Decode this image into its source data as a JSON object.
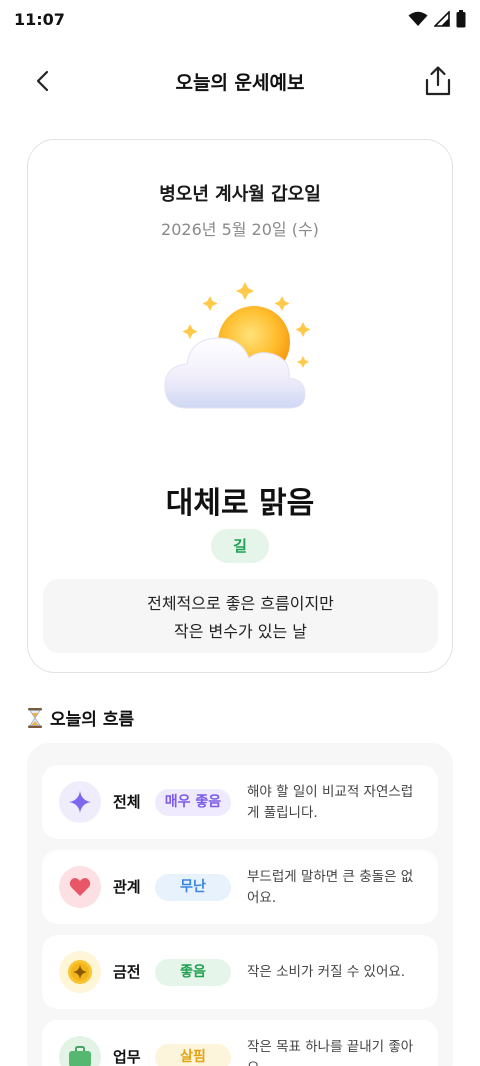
{
  "status_bar": {
    "time": "11:07",
    "icons": [
      "wifi-icon",
      "signal-icon",
      "battery-icon"
    ]
  },
  "header": {
    "title": "오늘의 운세예보",
    "back_icon": "back-arrow-icon",
    "share_icon": "share-icon"
  },
  "fortune": {
    "ganji": "병오년 계사월 갑오일",
    "date": "2026년 5월 20일 (수)",
    "weather_icon": "sun-behind-cloud-icon",
    "weather_label": "대체로 맑음",
    "grade": "길",
    "summary_line1": "전체적으로 좋은 흐름이지만",
    "summary_line2": "작은 변수가 있는 날"
  },
  "flow": {
    "title": "오늘의 흐름",
    "title_icon": "hourglass-icon",
    "items": [
      {
        "name": "전체",
        "status": "매우 좋음",
        "desc": "해야 할 일이 비교적 자연스럽게 풀립니다.",
        "icon": "sparkle-icon"
      },
      {
        "name": "관계",
        "status": "무난",
        "desc": "부드럽게 말하면 큰 충돌은 없어요.",
        "icon": "heart-icon"
      },
      {
        "name": "금전",
        "status": "좋음",
        "desc": "작은 소비가 커질 수 있어요.",
        "icon": "coin-icon"
      },
      {
        "name": "업무",
        "status": "살핌",
        "desc": "작은 목표 하나를 끝내기 좋아요.",
        "icon": "briefcase-icon"
      }
    ]
  },
  "colors": {
    "grade_bg": "#e6f5ea",
    "grade_text": "#20a052",
    "very_good_bg": "#efeafd",
    "very_good_text": "#7b5ce6",
    "neutral_bg": "#e8f2fd",
    "neutral_text": "#3b86e0",
    "good_bg": "#e6f5ea",
    "good_text": "#20a052",
    "caution_bg": "#fdf4dc",
    "caution_text": "#e2a412"
  }
}
